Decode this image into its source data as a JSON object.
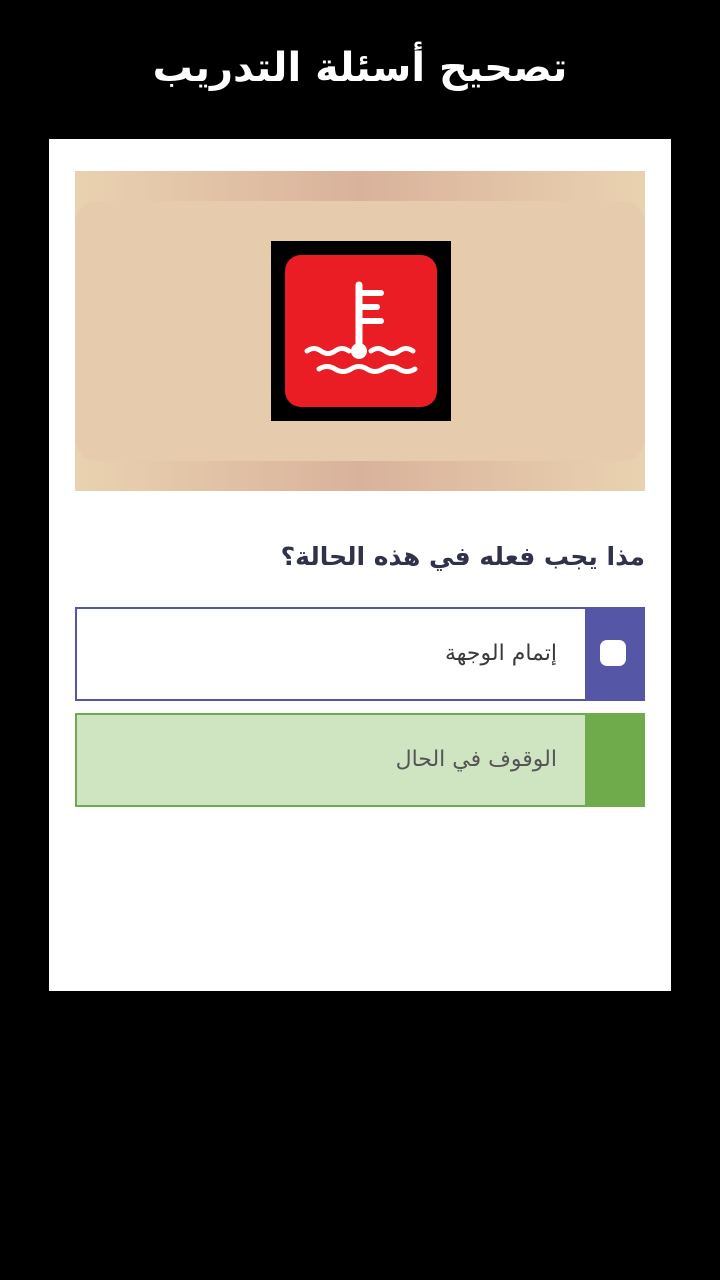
{
  "header": {
    "title": "تصحيح أسئلة التدريب"
  },
  "quiz": {
    "image_icon": "coolant-temperature-warning-icon",
    "question": "مذا يجب فعله في هذه الحالة؟",
    "options": [
      {
        "label": "إتمام الوجهة",
        "selected": false,
        "state": "unchecked"
      },
      {
        "label": "الوقوف في الحال",
        "selected": false,
        "state": "correct"
      }
    ]
  },
  "colors": {
    "background": "#000000",
    "card": "#ffffff",
    "accent_purple": "#5557a6",
    "correct_green": "#6fab4a",
    "correct_fill": "#cfe4c0",
    "warning_red": "#ea1c24"
  }
}
